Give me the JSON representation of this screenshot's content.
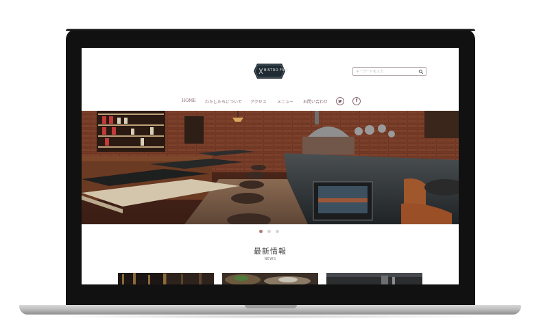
{
  "site": {
    "logo_text": "BISTRO FIRE",
    "search": {
      "placeholder": "キーワードを入力"
    },
    "nav": {
      "items": [
        {
          "label": "HOME"
        },
        {
          "label": "わたしたちについて"
        },
        {
          "label": "アクセス"
        },
        {
          "label": "メニュー"
        },
        {
          "label": "お問い合わせ"
        }
      ],
      "social": [
        {
          "icon": "twitter-icon",
          "glyph": "🐦"
        },
        {
          "icon": "facebook-icon",
          "glyph": "f"
        }
      ]
    },
    "hero": {
      "slide_count": 3,
      "active_slide": 1
    },
    "news": {
      "title": "最新情報",
      "subtitle": "NEWS",
      "thumbnails": 3
    }
  },
  "colors": {
    "nav_text": "#8a6a76",
    "dot_active": "#a98172",
    "dot_inactive": "#d6d6d6",
    "logo_bg": "#1f2b33"
  }
}
